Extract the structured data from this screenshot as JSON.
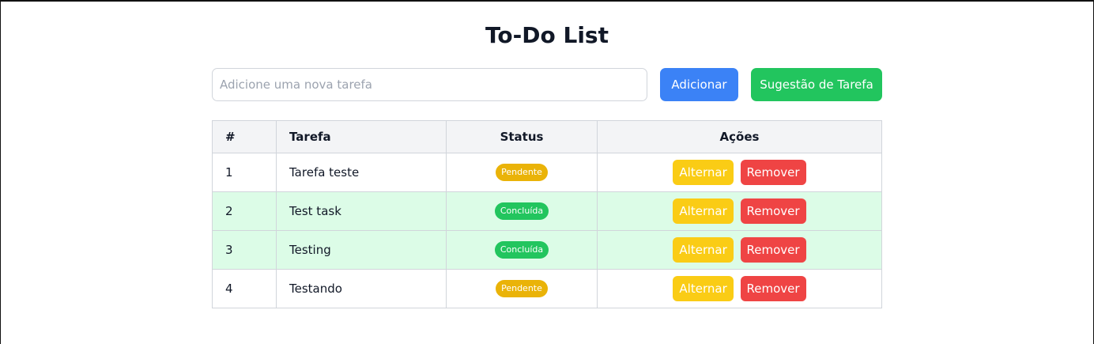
{
  "title": "To-Do List",
  "input": {
    "placeholder": "Adicione uma nova tarefa",
    "value": ""
  },
  "buttons": {
    "add": "Adicionar",
    "suggest": "Sugestão de Tarefa"
  },
  "table": {
    "headers": {
      "num": "#",
      "task": "Tarefa",
      "status": "Status",
      "actions": "Ações"
    },
    "rows": [
      {
        "num": "1",
        "task": "Tarefa teste",
        "status": "Pendente",
        "done": false,
        "toggle": "Alternar",
        "remove": "Remover"
      },
      {
        "num": "2",
        "task": "Test task",
        "status": "Concluída",
        "done": true,
        "toggle": "Alternar",
        "remove": "Remover"
      },
      {
        "num": "3",
        "task": "Testing",
        "status": "Concluída",
        "done": true,
        "toggle": "Alternar",
        "remove": "Remover"
      },
      {
        "num": "4",
        "task": "Testando",
        "status": "Pendente",
        "done": false,
        "toggle": "Alternar",
        "remove": "Remover"
      }
    ]
  },
  "colors": {
    "add_button": "#3b82f6",
    "suggest_button": "#22c55e",
    "pending_badge": "#eab308",
    "done_badge": "#22c55e",
    "toggle_button": "#facc15",
    "remove_button": "#ef4444",
    "done_row_bg": "#dcfce7"
  }
}
